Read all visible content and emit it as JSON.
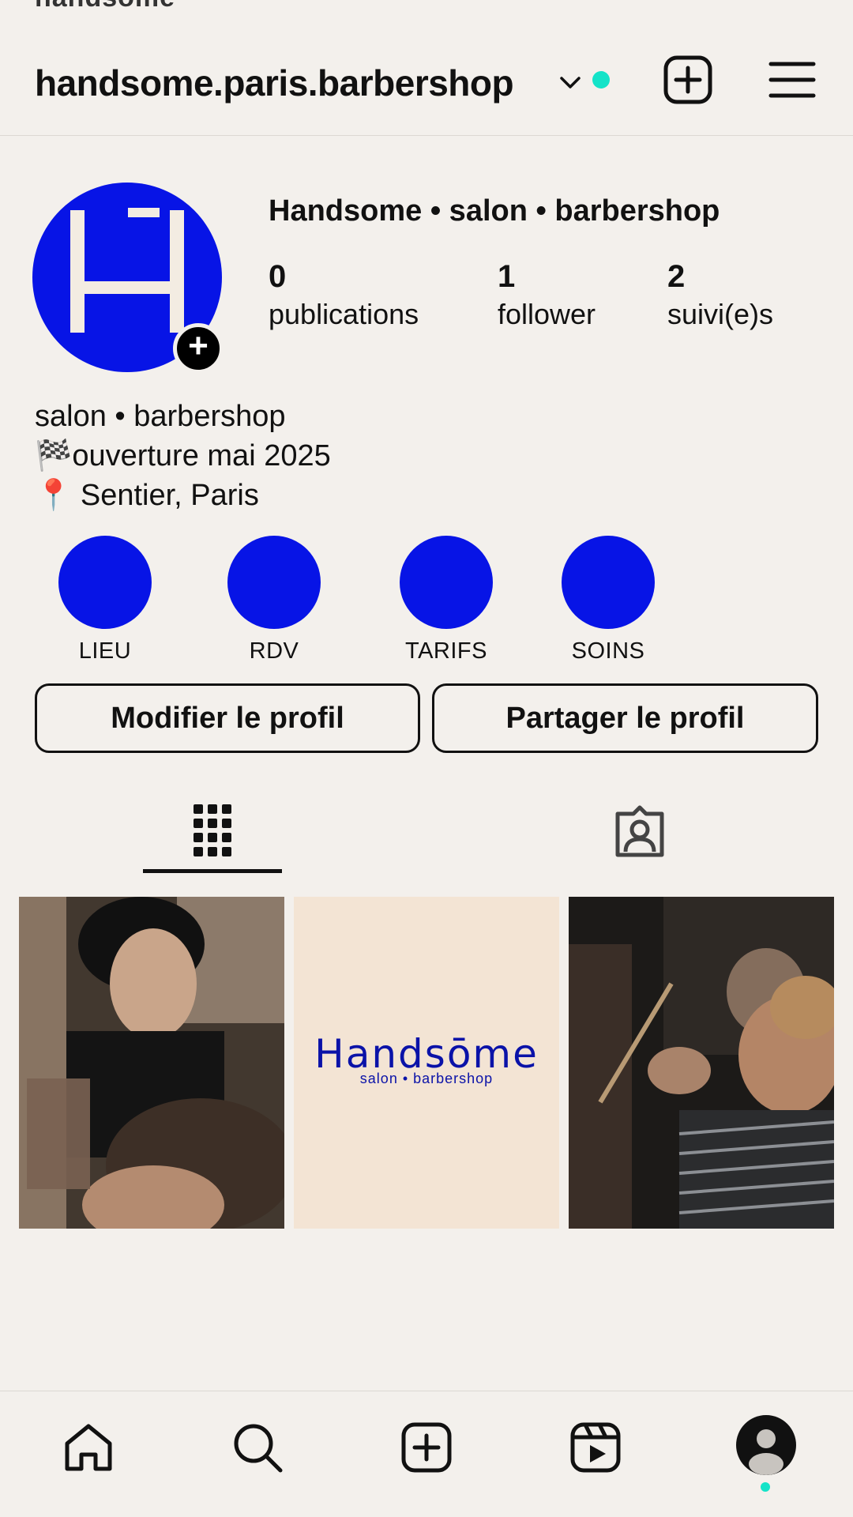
{
  "status_bar": {
    "text": "handsome"
  },
  "header": {
    "username": "handsome.paris.barbershop"
  },
  "profile": {
    "display_name": "Handsome • salon • barbershop",
    "stats": [
      {
        "value": "0",
        "label": "publications"
      },
      {
        "value": "1",
        "label": "follower"
      },
      {
        "value": "2",
        "label": "suivi(e)s"
      }
    ],
    "bio": [
      "salon • barbershop",
      "🏁ouverture mai 2025",
      "📍 Sentier, Paris"
    ]
  },
  "highlights": [
    {
      "label": "LIEU"
    },
    {
      "label": "RDV"
    },
    {
      "label": "TARIFS"
    },
    {
      "label": "SOINS"
    }
  ],
  "buttons": {
    "edit": "Modifier le profil",
    "share": "Partager le profil"
  },
  "posts": {
    "brand_title": "Handsōme",
    "brand_subtitle": "salon • barbershop"
  },
  "colors": {
    "accent_blue": "#0714e6",
    "online_teal": "#14e3c8",
    "background": "#f3f0ec",
    "post_beige": "#f3e4d4"
  },
  "icons": {
    "header": [
      "chevron-down-icon",
      "add-post-icon",
      "menu-icon"
    ],
    "tabs": [
      "grid-icon",
      "tagged-icon"
    ],
    "nav": [
      "home-icon",
      "search-icon",
      "create-icon",
      "reels-icon",
      "profile-icon"
    ]
  }
}
